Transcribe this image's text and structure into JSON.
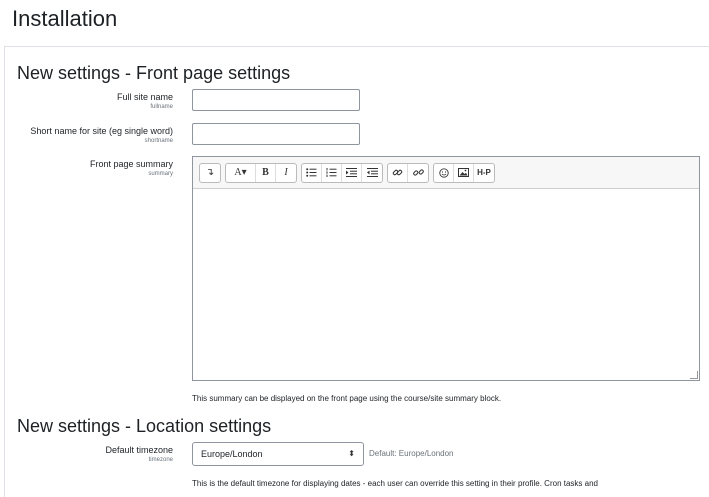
{
  "page": {
    "title": "Installation"
  },
  "front_page": {
    "heading": "New settings - Front page settings",
    "full_site_name": {
      "label": "Full site name",
      "name": "fullname",
      "value": ""
    },
    "short_name": {
      "label": "Short name for site (eg single word)",
      "name": "shortname",
      "value": ""
    },
    "summary": {
      "label": "Front page summary",
      "name": "summary",
      "help": "This summary can be displayed on the front page using the course/site summary block."
    },
    "toolbar": {
      "collapse": "↴",
      "font": "A▾",
      "bold": "B",
      "italic": "I",
      "h5p": "H-P"
    }
  },
  "location": {
    "heading": "New settings - Location settings",
    "timezone": {
      "label": "Default timezone",
      "name": "timezone",
      "value": "Europe/London",
      "default_note": "Default: Europe/London",
      "help": "This is the default timezone for displaying dates - each user can override this setting in their profile. Cron tasks and"
    }
  },
  "icons": [
    "collapse-icon",
    "font-style-icon",
    "bold-icon",
    "italic-icon",
    "unordered-list-icon",
    "ordered-list-icon",
    "indent-icon",
    "outdent-icon",
    "link-icon",
    "unlink-icon",
    "emoji-icon",
    "image-icon",
    "h5p-icon",
    "chevron-updown-icon"
  ]
}
